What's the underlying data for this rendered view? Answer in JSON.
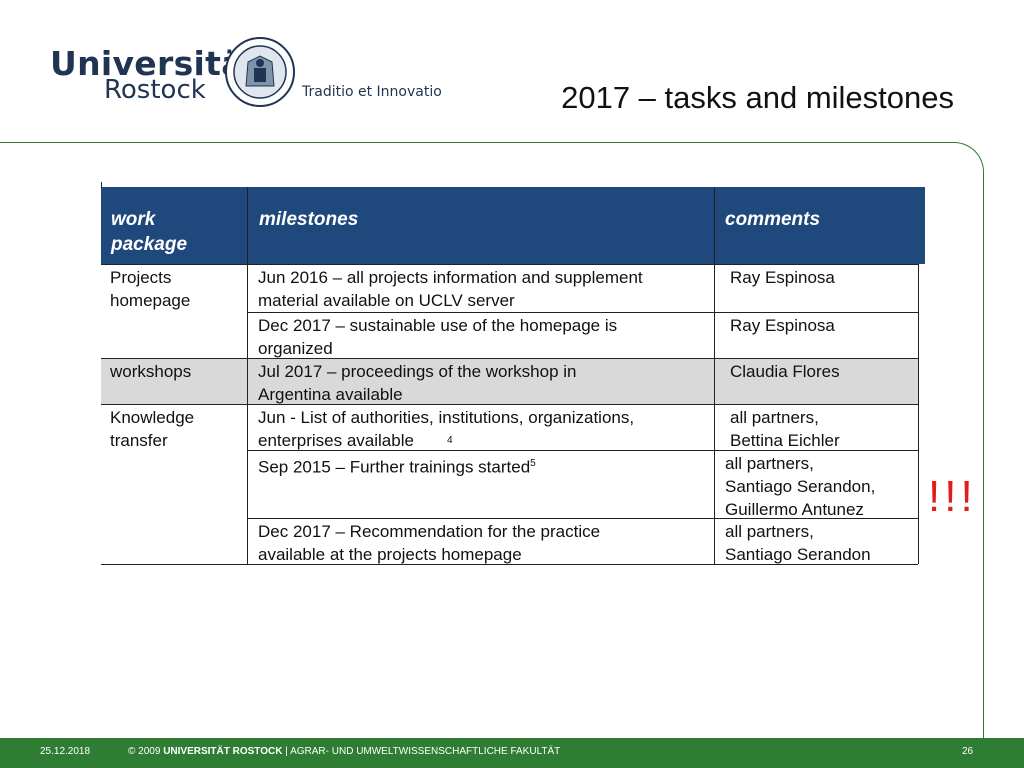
{
  "header": {
    "logo_line1": "Universität",
    "logo_line2": "Rostock",
    "motto": "Traditio et Innovatio",
    "title": "2017 – tasks and milestones"
  },
  "table": {
    "headers": [
      "work package",
      "milestones",
      "comments"
    ],
    "rows": [
      {
        "package": "Projects\nhomepage",
        "milestone": "Jun 2016 – all projects information and supplement\nmaterial available on UCLV server",
        "comment": "Ray Espinosa"
      },
      {
        "package": "",
        "milestone": "Dec 2017 – sustainable  use of the homepage is\norganized",
        "comment": "Ray Espinosa"
      },
      {
        "package": "workshops",
        "milestone": "Jul 2017 – proceedings of the workshop in\nArgentina available",
        "comment": "Claudia Flores"
      },
      {
        "package": "Knowledge\ntransfer",
        "milestone": "Jun -  List of authorities, institutions, organizations,\nenterprises available",
        "milestone_note": "4",
        "comment": "all partners,\nBettina Eichler"
      },
      {
        "package": "",
        "milestone": "Sep 2015 – Further trainings started",
        "milestone_note": "5",
        "comment": "all partners,\nSantiago Serandon,\nGuillermo Antunez"
      },
      {
        "package": "",
        "milestone": "Dec 2017 – Recommendation  for the practice\navailable at the projects homepage",
        "comment": "all partners,\nSantiago Serandon"
      }
    ]
  },
  "emphasis": "!!!",
  "footer": {
    "date": "25.12.2018",
    "copyright_prefix": "© 2009",
    "university": "UNIVERSITÄT ROSTOCK",
    "faculty": "| AGRAR- UND UMWELTWISSENSCHAFTLICHE FAKULTÄT",
    "page": "26"
  },
  "colors": {
    "header_fill": "#1f497d",
    "accent_green": "#2e7d32",
    "highlight_row": "#d9d9d9",
    "emphasis_red": "#e41b17"
  }
}
